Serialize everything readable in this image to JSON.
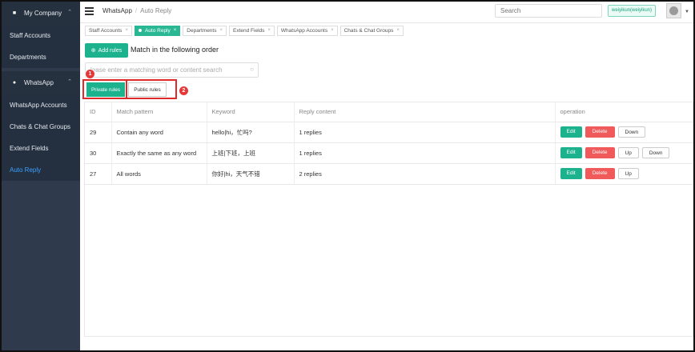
{
  "sidebar": {
    "groups": [
      {
        "label": "My Company",
        "icon": "building-icon",
        "items": [
          "Staff Accounts",
          "Departments"
        ]
      },
      {
        "label": "WhatsApp",
        "icon": "whatsapp-icon",
        "items": [
          "WhatsApp Accounts",
          "Chats & Chat Groups",
          "Extend Fields",
          "Auto Reply"
        ]
      }
    ],
    "active_item": "Auto Reply"
  },
  "topbar": {
    "breadcrumb": [
      "WhatsApp",
      "Auto Reply"
    ],
    "breadcrumb_sep": "/",
    "search_placeholder": "Search",
    "user": "weiyikun(weiyikun)"
  },
  "tabs": [
    {
      "label": "Staff Accounts",
      "active": false
    },
    {
      "label": "Auto Reply",
      "active": true
    },
    {
      "label": "Departments",
      "active": false
    },
    {
      "label": "Extend Fields",
      "active": false
    },
    {
      "label": "WhatsApp Accounts",
      "active": false
    },
    {
      "label": "Chats & Chat Groups",
      "active": false
    }
  ],
  "toolbar": {
    "add_label": "Add rules",
    "order_text": "Match in the following order",
    "search_placeholder": "lease enter a matching word or content search"
  },
  "rule_tabs": {
    "private": "Private rules",
    "public": "Public rules"
  },
  "annotations": {
    "one": "1",
    "two": "2"
  },
  "table": {
    "headers": [
      "ID",
      "Match pattern",
      "Keyword",
      "Reply content",
      "operation"
    ],
    "rows": [
      {
        "id": "29",
        "pattern": "Contain any word",
        "keyword": "hello|hi，忙吗?",
        "reply": "1 replies",
        "ops": [
          "Edit",
          "Delete",
          "Down"
        ]
      },
      {
        "id": "30",
        "pattern": "Exactly the same as any word",
        "keyword": "上班|下班，上班",
        "reply": "1 replies",
        "ops": [
          "Edit",
          "Delete",
          "Up",
          "Down"
        ]
      },
      {
        "id": "27",
        "pattern": "All words",
        "keyword": "你好|hi，天气不错",
        "reply": "2 replies",
        "ops": [
          "Edit",
          "Delete",
          "Up"
        ]
      }
    ]
  },
  "colors": {
    "accent": "#1cb28e",
    "danger": "#f05a5a",
    "sidebar": "#2f3b4c",
    "highlight": "#e02a2a"
  }
}
